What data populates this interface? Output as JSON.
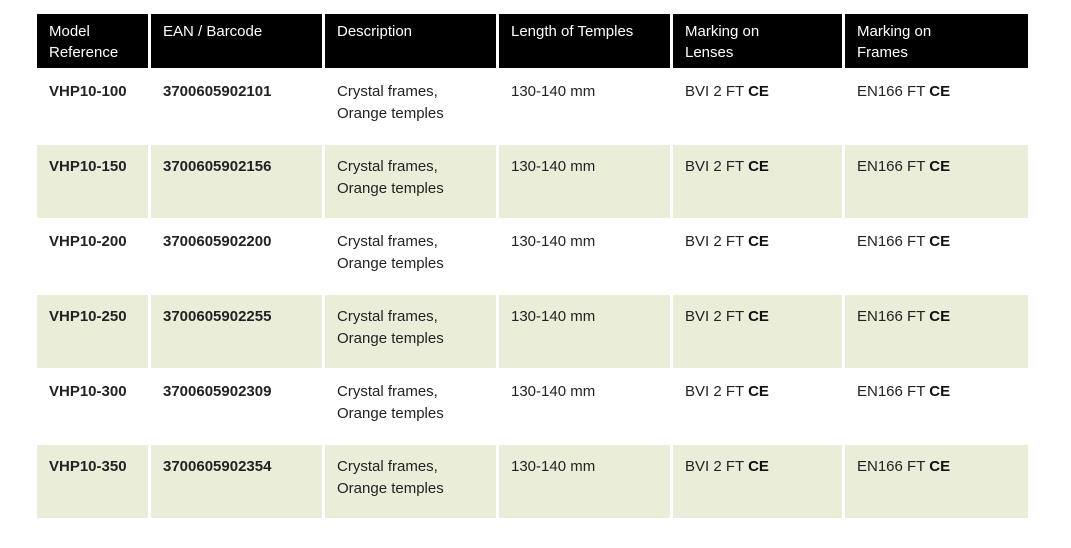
{
  "table": {
    "headers": [
      "Model Reference",
      "EAN / Barcode",
      "Description",
      "Length of Temples",
      "Marking on Lenses",
      "Marking on Frames"
    ],
    "header_lines": [
      [
        "Model",
        "Reference"
      ],
      [
        "EAN / Barcode"
      ],
      [
        "Description"
      ],
      [
        "Length of Temples"
      ],
      [
        "Marking on",
        "Lenses"
      ],
      [
        "Marking on",
        "Frames"
      ]
    ],
    "rows": [
      {
        "model": "VHP10-100",
        "ean": "3700605902101",
        "desc1": "Crystal frames,",
        "desc2": "Orange temples",
        "length": "130-140 mm",
        "lens_mark": "BVI 2 FT",
        "lens_ce": "CE",
        "frame_mark": "EN166 FT",
        "frame_ce": "CE"
      },
      {
        "model": "VHP10-150",
        "ean": "3700605902156",
        "desc1": "Crystal frames,",
        "desc2": "Orange temples",
        "length": "130-140 mm",
        "lens_mark": "BVI 2 FT",
        "lens_ce": "CE",
        "frame_mark": "EN166 FT",
        "frame_ce": "CE"
      },
      {
        "model": "VHP10-200",
        "ean": "3700605902200",
        "desc1": "Crystal frames,",
        "desc2": "Orange temples",
        "length": "130-140 mm",
        "lens_mark": "BVI 2 FT",
        "lens_ce": "CE",
        "frame_mark": "EN166 FT",
        "frame_ce": "CE"
      },
      {
        "model": "VHP10-250",
        "ean": "3700605902255",
        "desc1": "Crystal frames,",
        "desc2": "Orange temples",
        "length": "130-140 mm",
        "lens_mark": "BVI 2 FT",
        "lens_ce": "CE",
        "frame_mark": "EN166 FT",
        "frame_ce": "CE"
      },
      {
        "model": "VHP10-300",
        "ean": "3700605902309",
        "desc1": "Crystal frames,",
        "desc2": "Orange temples",
        "length": "130-140 mm",
        "lens_mark": "BVI 2 FT",
        "lens_ce": "CE",
        "frame_mark": "EN166 FT",
        "frame_ce": "CE"
      },
      {
        "model": "VHP10-350",
        "ean": "3700605902354",
        "desc1": "Crystal frames,",
        "desc2": "Orange temples",
        "length": "130-140 mm",
        "lens_mark": "BVI 2 FT",
        "lens_ce": "CE",
        "frame_mark": "EN166 FT",
        "frame_ce": "CE"
      }
    ]
  },
  "colors": {
    "header_bg": "#000000",
    "alt_row_bg": "#eaeed9",
    "barcode": "#e8782e"
  }
}
